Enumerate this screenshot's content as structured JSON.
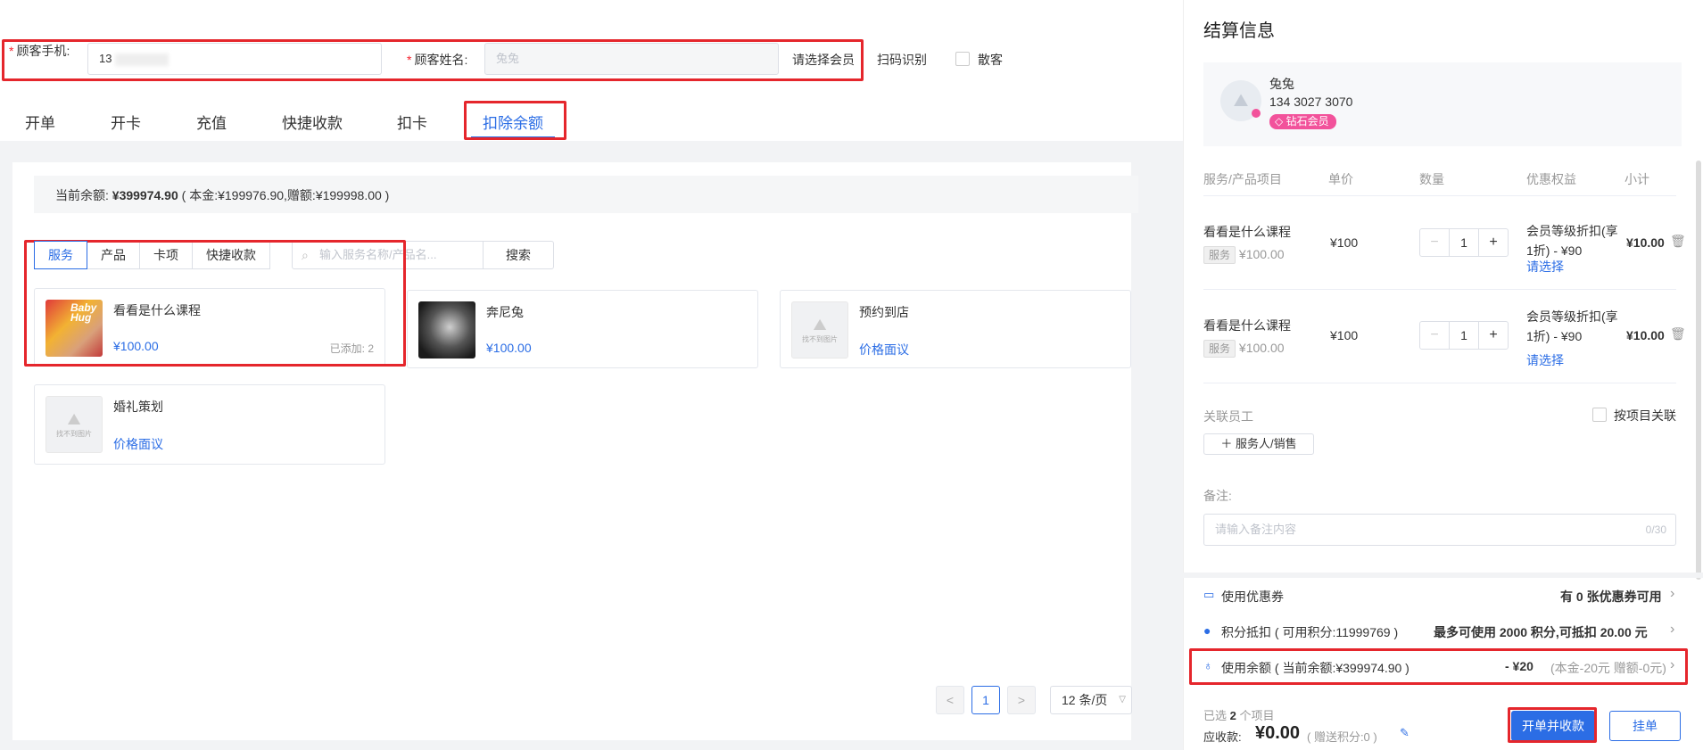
{
  "customer": {
    "phone_label": "顾客手机:",
    "phone_value": "13",
    "name_label": "顾客姓名:",
    "name_value": "兔兔",
    "select_member": "请选择会员",
    "scan": "扫码识别",
    "walk_in": "散客"
  },
  "tabs": [
    "开单",
    "开卡",
    "充值",
    "快捷收款",
    "扣卡",
    "扣除余额"
  ],
  "balance": {
    "label": "当前余额:",
    "amount": "¥399974.90",
    "detail": "( 本金:¥199976.90,赠额:¥199998.00 )"
  },
  "categories": [
    "服务",
    "产品",
    "卡项",
    "快捷收款"
  ],
  "search": {
    "placeholder": "输入服务名称/产品名...",
    "button": "搜索"
  },
  "products": [
    {
      "name": "看看是什么课程",
      "price": "¥100.00",
      "added": "已添加: 2"
    },
    {
      "name": "奔尼兔",
      "price": "¥100.00"
    },
    {
      "name": "预约到店",
      "price": "价格面议",
      "img_text": "找不到图片"
    },
    {
      "name": "婚礼策划",
      "price": "价格面议",
      "img_text": "找不到图片"
    }
  ],
  "thumb_text": {
    "first": "Baby Hug"
  },
  "pagination": {
    "prev": "<",
    "page": "1",
    "next": ">",
    "page_size": "12 条/页"
  },
  "settlement": {
    "title": "结算信息",
    "member_name": "兔兔",
    "member_phone": "134 3027 3070",
    "member_level": "钻石会员",
    "columns": [
      "服务/产品项目",
      "单价",
      "数量",
      "优惠权益",
      "小计"
    ],
    "items": [
      {
        "name": "看看是什么课程",
        "tag": "服务",
        "orig_price": "¥100.00",
        "unit_price": "¥100",
        "qty": "1",
        "discount_line1": "会员等级折扣(享",
        "discount_line2": "1折) - ¥90",
        "choose": "请选择",
        "subtotal": "¥10.00"
      },
      {
        "name": "看看是什么课程",
        "tag": "服务",
        "orig_price": "¥100.00",
        "unit_price": "¥100",
        "qty": "1",
        "discount_line1": "会员等级折扣(享",
        "discount_line2": "1折) - ¥90",
        "choose": "请选择",
        "subtotal": "¥10.00"
      }
    ],
    "staff_label": "关联员工",
    "by_item_label": "按项目关联",
    "add_staff": "服务人/销售",
    "note_label": "备注:",
    "note_placeholder": "请输入备注内容",
    "note_count": "0/30",
    "coupon_label": "使用优惠券",
    "coupon_value_pre": "有 ",
    "coupon_count": "0",
    "coupon_value_post": " 张优惠券可用",
    "points_label": "积分抵扣 ( 可用积分:11999769 )",
    "points_value": "最多可使用 2000 积分,可抵扣 20.00 元",
    "balance_label": "使用余额 ( 当前余额:¥399974.90 )",
    "balance_value": "- ¥20",
    "balance_detail": "(本金-20元 赠额-0元)",
    "selected_pre": "已选 ",
    "selected_count": "2",
    "selected_post": " 个项目",
    "receivable_label": "应收款:",
    "receivable_value": "¥0.00",
    "gift_points": "( 赠送积分:0 )",
    "checkout_button": "开单并收款",
    "hold_button": "挂单"
  },
  "colors": {
    "accent": "#2b6de5",
    "highlight_box": "#e5262c",
    "member_badge": "#f2529b"
  }
}
